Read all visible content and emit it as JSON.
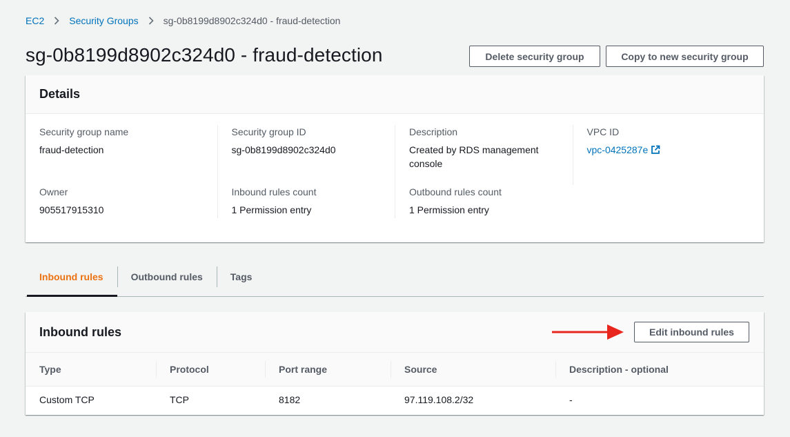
{
  "breadcrumb": {
    "items": [
      "EC2",
      "Security Groups"
    ],
    "current": "sg-0b8199d8902c324d0 - fraud-detection"
  },
  "page": {
    "title": "sg-0b8199d8902c324d0 - fraud-detection",
    "delete_label": "Delete security group",
    "copy_label": "Copy to new security group"
  },
  "details": {
    "title": "Details",
    "fields": [
      {
        "label": "Security group name",
        "value": "fraud-detection"
      },
      {
        "label": "Security group ID",
        "value": "sg-0b8199d8902c324d0"
      },
      {
        "label": "Description",
        "value": "Created by RDS management console"
      },
      {
        "label": "VPC ID",
        "value": "vpc-0425287e"
      },
      {
        "label": "Owner",
        "value": "905517915310"
      },
      {
        "label": "Inbound rules count",
        "value": "1 Permission entry"
      },
      {
        "label": "Outbound rules count",
        "value": "1 Permission entry"
      }
    ]
  },
  "tabs": [
    "Inbound rules",
    "Outbound rules",
    "Tags"
  ],
  "active_tab": "Inbound rules",
  "inbound": {
    "title": "Inbound rules",
    "edit_label": "Edit inbound rules",
    "columns": [
      "Type",
      "Protocol",
      "Port range",
      "Source",
      "Description - optional"
    ],
    "rows": [
      [
        "Custom TCP",
        "TCP",
        "8182",
        "97.119.108.2/32",
        "-"
      ]
    ]
  },
  "colors": {
    "link": "#0073bb",
    "active_tab": "#ec7211",
    "annotation_arrow": "#e8261d"
  }
}
